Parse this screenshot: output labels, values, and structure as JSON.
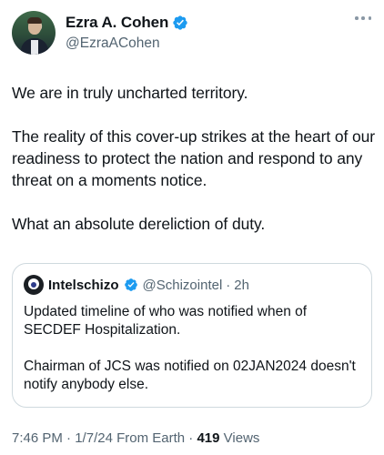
{
  "author": {
    "display_name": "Ezra A. Cohen",
    "handle": "@EzraACohen"
  },
  "tweet": {
    "paragraphs": [
      "We are in truly uncharted territory.",
      "The reality of this cover-up strikes at the heart of our readiness to protect the nation and respond to any threat on a moments notice.",
      "What an absolute dereliction of duty."
    ]
  },
  "quoted_tweet": {
    "display_name": "Intelschizo",
    "handle": "@Schizointel",
    "separator": "·",
    "time": "2h",
    "paragraphs": [
      "Updated timeline of who was notified when of SECDEF Hospitalization.",
      "Chairman of JCS was notified on 02JAN2024 doesn't notify anybody else."
    ]
  },
  "meta": {
    "time": "7:46 PM",
    "sep1": "·",
    "date": "1/7/24",
    "source": "From Earth",
    "sep2": "·",
    "views_count": "419",
    "views_label": "Views"
  },
  "colors": {
    "verified_blue": "#1d9bf0",
    "text_primary": "#0f1419",
    "text_secondary": "#536471",
    "border": "#cfd9de"
  },
  "icons": {
    "verified": "verified-badge-icon",
    "more": "more-horizontal-icon"
  }
}
